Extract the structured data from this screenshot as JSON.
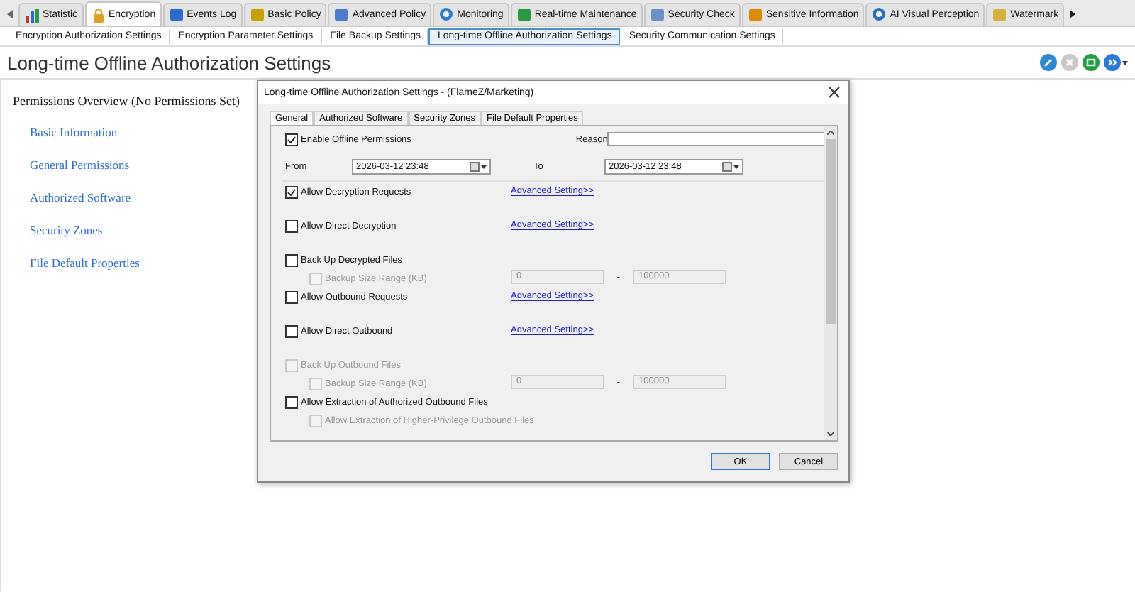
{
  "main_tabs": [
    {
      "label": "Statistic",
      "selected": false
    },
    {
      "label": "Encryption",
      "selected": true
    },
    {
      "label": "Events Log",
      "selected": false
    },
    {
      "label": "Basic Policy",
      "selected": false
    },
    {
      "label": "Advanced Policy",
      "selected": false
    },
    {
      "label": "Monitoring",
      "selected": false
    },
    {
      "label": "Real-time Maintenance",
      "selected": false
    },
    {
      "label": "Security Check",
      "selected": false
    },
    {
      "label": "Sensitive Information",
      "selected": false
    },
    {
      "label": "AI Visual Perception",
      "selected": false
    },
    {
      "label": "Watermark",
      "selected": false
    }
  ],
  "sub_tabs": [
    {
      "label": "Encryption Authorization Settings",
      "selected": false
    },
    {
      "label": "Encryption Parameter Settings",
      "selected": false
    },
    {
      "label": "File Backup Settings",
      "selected": false
    },
    {
      "label": "Long-time Offline Authorization Settings",
      "selected": true
    },
    {
      "label": "Security Communication Settings",
      "selected": false
    }
  ],
  "page_title": "Long-time Offline Authorization Settings",
  "toolbar": [
    {
      "kind": "edit",
      "disabled": false
    },
    {
      "kind": "delete",
      "disabled": true
    },
    {
      "kind": "export",
      "disabled": false
    },
    {
      "kind": "more",
      "disabled": false
    }
  ],
  "sidebar": {
    "heading": "Permissions Overview (No Permissions Set)",
    "items": [
      "Basic Information",
      "General Permissions",
      "Authorized Software",
      "Security Zones",
      "File Default Properties"
    ]
  },
  "dialog": {
    "title": "Long-time Offline Authorization Settings - (FlameZ/Marketing)",
    "tabs": [
      {
        "label": "General",
        "selected": true
      },
      {
        "label": "Authorized Software",
        "selected": false
      },
      {
        "label": "Security Zones",
        "selected": false
      },
      {
        "label": "File Default Properties",
        "selected": false
      }
    ],
    "enable": {
      "label": "Enable Offline Permissions",
      "checked": true
    },
    "reason_label": "Reason",
    "from_label": "From",
    "from_value": "2026-03-12 23:48",
    "to_label": "To",
    "to_value": "2026-03-12 23:48",
    "options": [
      {
        "kind": "check",
        "label": "Allow Decryption Requests",
        "checked": true,
        "disabled": false,
        "link": "Advanced Setting>>"
      },
      {
        "kind": "check",
        "label": "Allow Direct Decryption",
        "checked": false,
        "disabled": false,
        "link": "Advanced Setting>>"
      },
      {
        "kind": "check",
        "label": "Back Up Decrypted Files",
        "checked": false,
        "disabled": false,
        "children": [
          {
            "kind": "range",
            "label": "Backup Size Range (KB)",
            "checked": false,
            "disabled": true,
            "min": "0",
            "separator": "-",
            "max": "100000"
          }
        ]
      },
      {
        "kind": "check",
        "label": "Allow Outbound Requests",
        "checked": false,
        "disabled": false,
        "link": "Advanced Setting>>"
      },
      {
        "kind": "check",
        "label": "Allow Direct Outbound",
        "checked": false,
        "disabled": false,
        "link": "Advanced Setting>>"
      },
      {
        "kind": "check",
        "label": "Back Up Outbound Files",
        "checked": false,
        "disabled": true,
        "children": [
          {
            "kind": "range",
            "label": "Backup Size Range (KB)",
            "checked": false,
            "disabled": true,
            "min": "0",
            "separator": "-",
            "max": "100000"
          }
        ]
      },
      {
        "kind": "check",
        "label": "Allow Extraction of Authorized Outbound Files",
        "checked": false,
        "disabled": false,
        "children": [
          {
            "kind": "check",
            "label": "Allow Extraction of Higher-Privilege Outbound Files",
            "checked": false,
            "disabled": true
          }
        ]
      }
    ],
    "buttons": [
      {
        "label": "OK",
        "default": true
      },
      {
        "label": "Cancel",
        "default": false
      }
    ]
  }
}
